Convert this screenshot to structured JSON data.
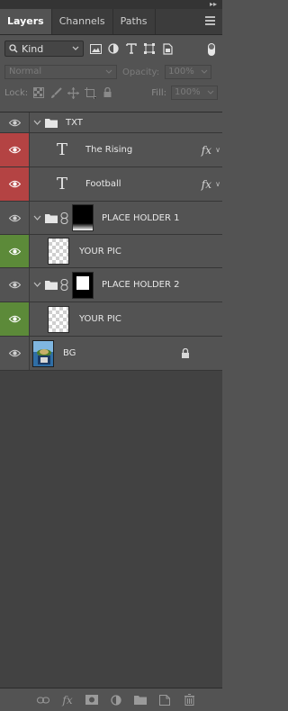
{
  "tabs": [
    "Layers",
    "Channels",
    "Paths"
  ],
  "filter": {
    "kind_label": "Kind"
  },
  "blend": {
    "mode": "Normal",
    "opacity_label": "Opacity:",
    "opacity_value": "100%"
  },
  "lock": {
    "lock_label": "Lock:",
    "fill_label": "Fill:",
    "fill_value": "100%"
  },
  "layers": [
    {
      "name": "TXT"
    },
    {
      "name": "The Rising"
    },
    {
      "name": "Football"
    },
    {
      "name": "PLACE HOLDER 1"
    },
    {
      "name": "YOUR PIC"
    },
    {
      "name": "PLACE HOLDER 2"
    },
    {
      "name": "YOUR PIC"
    },
    {
      "name": "BG"
    }
  ],
  "colors": {
    "red_eye": "#b44343",
    "green_eye": "#5c8a39",
    "panel": "#535353"
  }
}
